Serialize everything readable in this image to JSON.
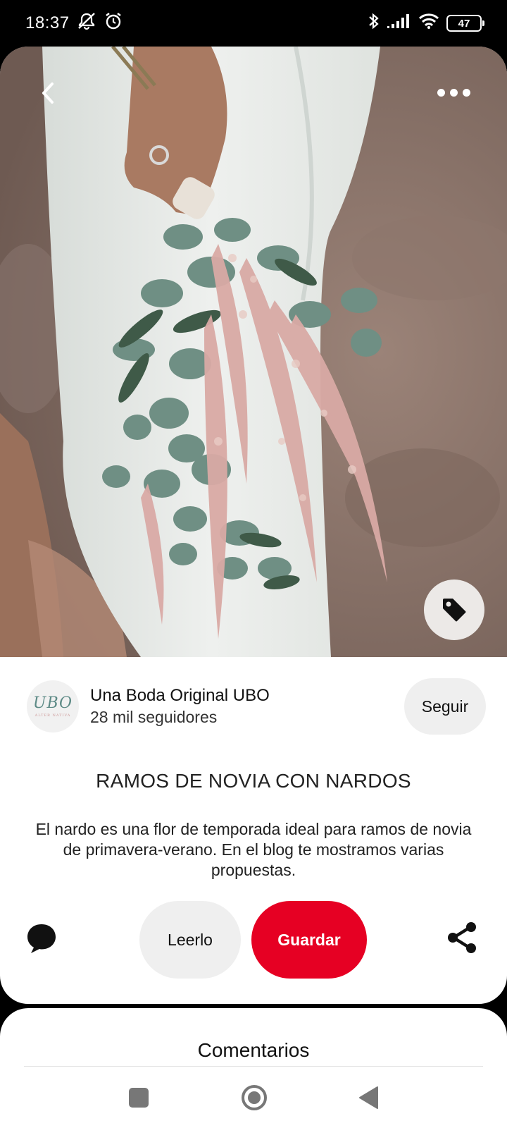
{
  "status_bar": {
    "time": "18:37",
    "battery": "47"
  },
  "pin": {
    "author": {
      "name": "Una Boda Original UBO",
      "followers": "28 mil seguidores",
      "avatar_text": "UBO",
      "avatar_subtext": "ALTER NATIVA"
    },
    "follow_label": "Seguir",
    "title": "RAMOS DE NOVIA CON NARDOS",
    "description": "El nardo es una flor de temporada ideal para ramos de novia de primavera-verano. En el blog te mostramos varias propuestas.",
    "read_label": "Leerlo",
    "save_label": "Guardar"
  },
  "comments": {
    "title": "Comentarios"
  },
  "icons": {
    "back": "back-arrow-icon",
    "more": "more-options-icon",
    "tag": "shopping-tag-icon",
    "comment": "comment-bubble-icon",
    "share": "share-icon"
  },
  "colors": {
    "save_button": "#e60023",
    "secondary_button": "#efefef"
  }
}
